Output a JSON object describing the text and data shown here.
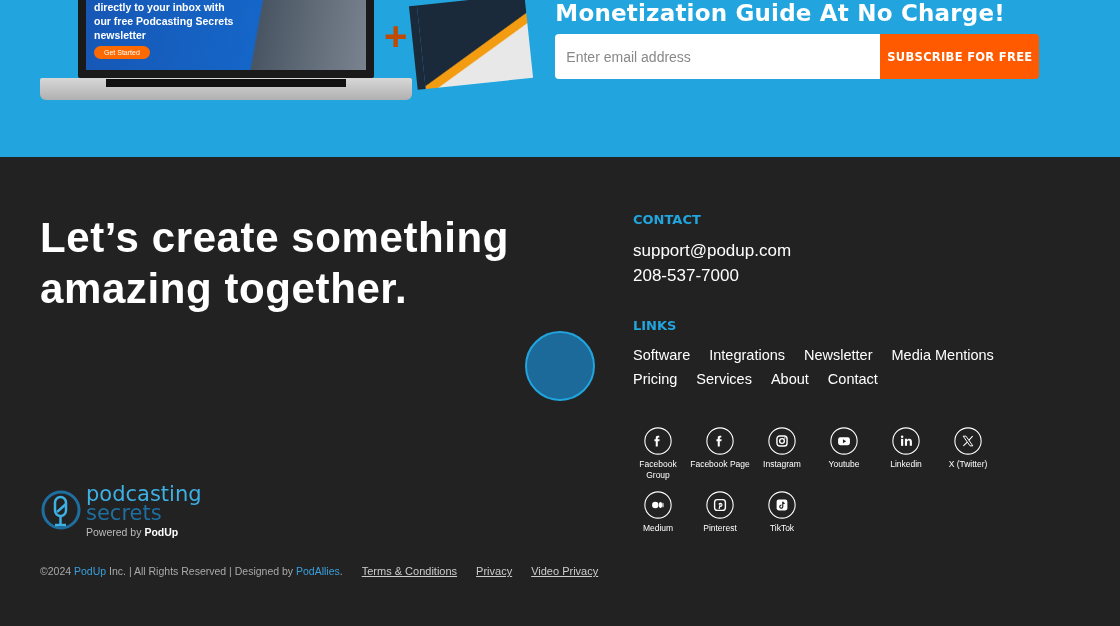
{
  "hero": {
    "laptop_text": "directly to your inbox with our free Podcasting Secrets newsletter",
    "laptop_button": "Get Started",
    "plus": "+",
    "title": "Monetization Guide At No Charge!",
    "email_field": {
      "placeholder": "Enter email address"
    },
    "subscribe_button": "SUBSCRIBE FOR FREE"
  },
  "footer": {
    "headline": "Let’s create something amazing together.",
    "contact": {
      "heading": "CONTACT",
      "email": "support@podup.com",
      "phone": "208-537-7000"
    },
    "links": {
      "heading": "LINKS",
      "items": [
        "Software",
        "Integrations",
        "Newsletter",
        "Media Mentions",
        "Pricing",
        "Services",
        "About",
        "Contact"
      ]
    },
    "social": [
      {
        "kind": "facebook",
        "label": "Facebook Group"
      },
      {
        "kind": "facebook",
        "label": "Facebook Page"
      },
      {
        "kind": "instagram",
        "label": "Instagram"
      },
      {
        "kind": "youtube",
        "label": "Youtube"
      },
      {
        "kind": "linkedin",
        "label": "Linkedin"
      },
      {
        "kind": "x",
        "label": "X (Twitter)"
      },
      {
        "kind": "medium",
        "label": "Medium"
      },
      {
        "kind": "pinterest",
        "label": "Pinterest"
      },
      {
        "kind": "tiktok",
        "label": "TikTok"
      }
    ],
    "logo": {
      "line1": "podcasting",
      "line2": "secrets",
      "tagline": "Powered by **PodUp**"
    },
    "copyright": {
      "prefix": "©2024 ",
      "link1": "PodUp",
      "middle": " Inc. | All Rights Reserved | Designed by ",
      "link2": "PodAllies",
      "suffix": "."
    },
    "legal_links": [
      "Terms & Conditions",
      "Privacy",
      "Video Privacy"
    ]
  }
}
